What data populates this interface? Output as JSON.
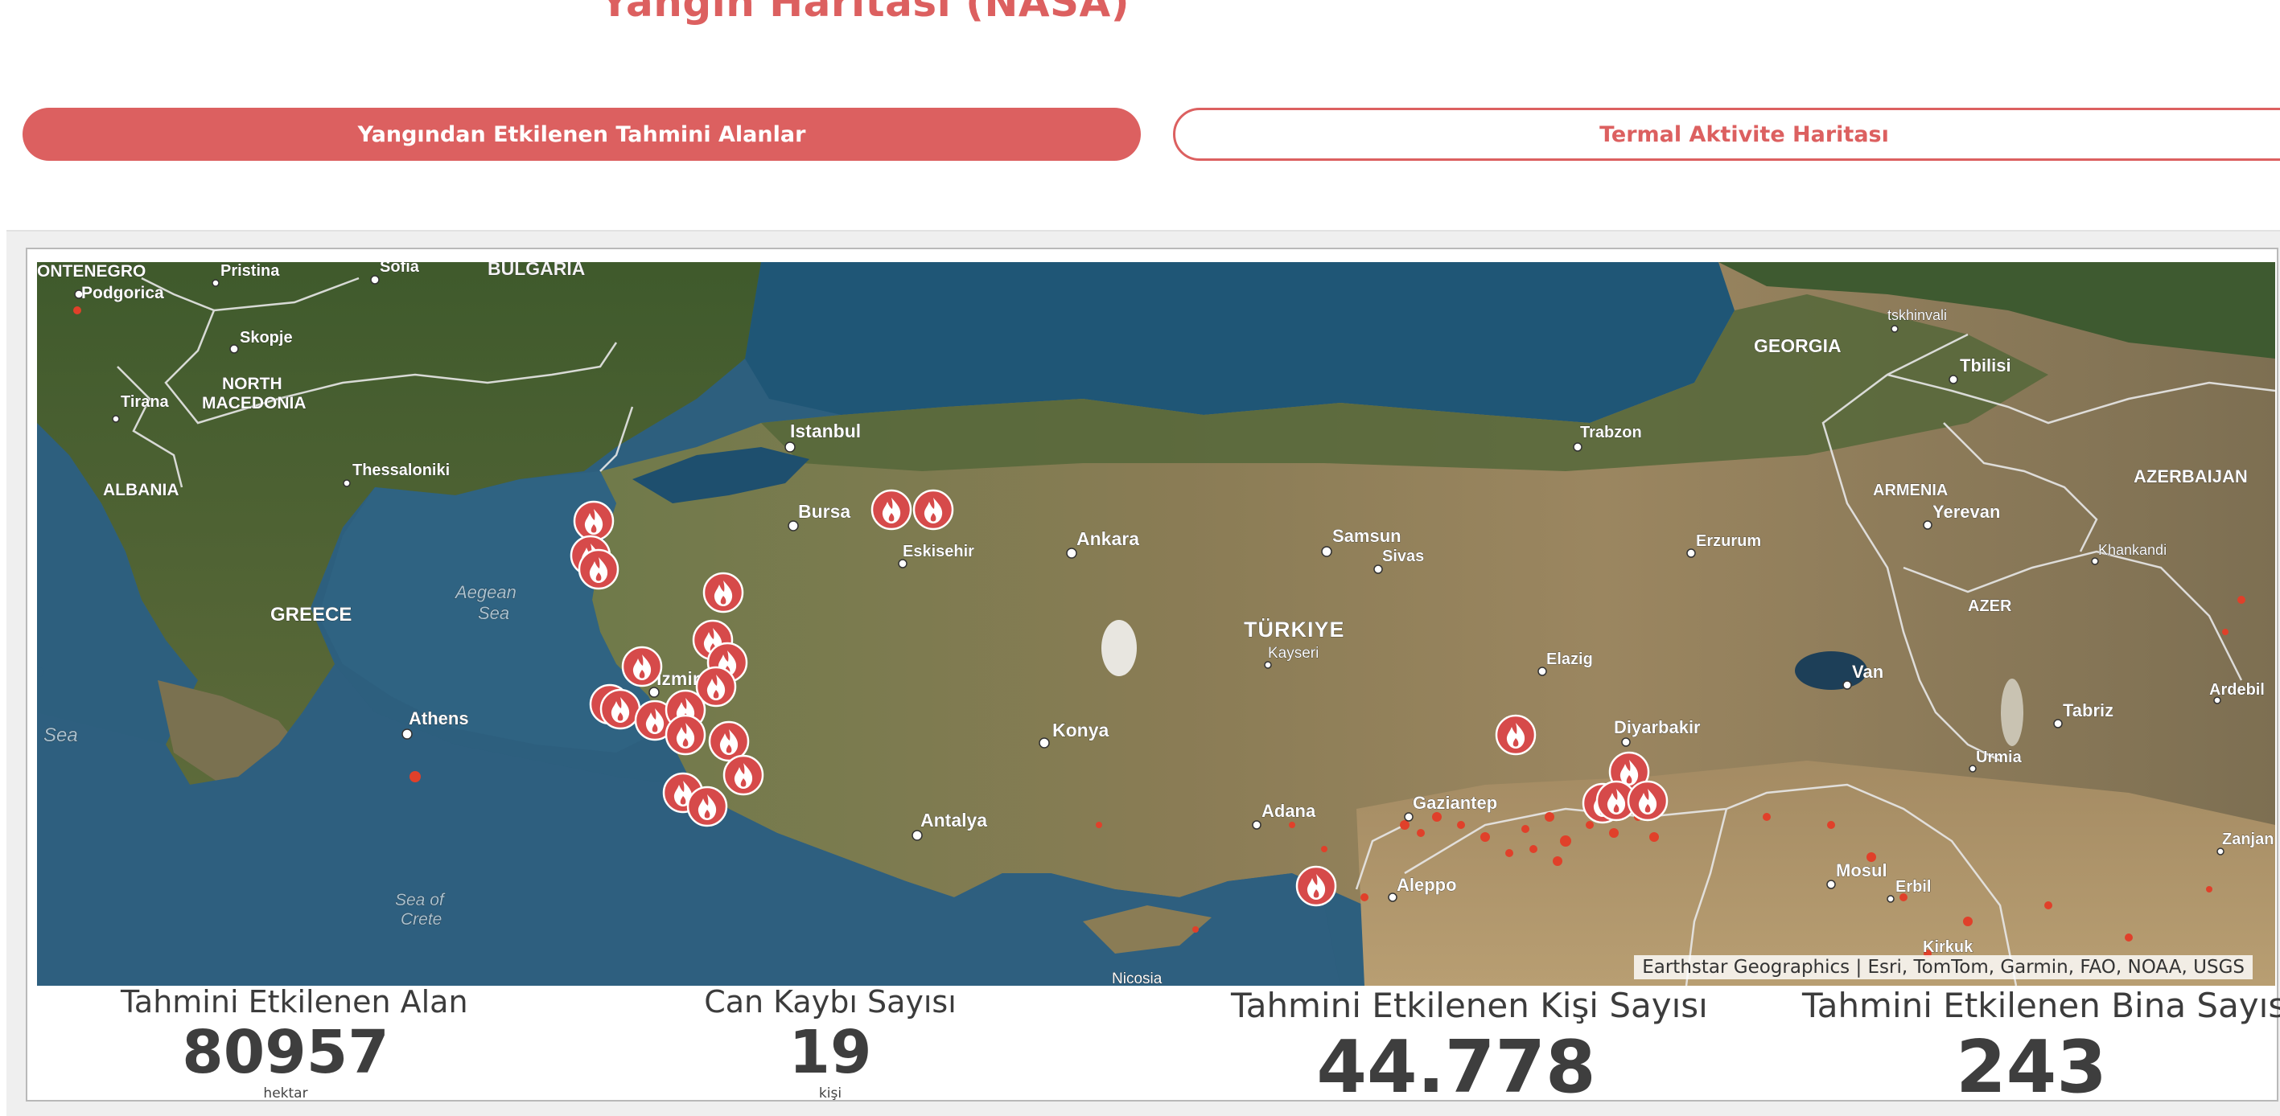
{
  "page": {
    "title": "Yangın Haritası (NASA)"
  },
  "tabs": [
    {
      "label": "Yangından Etkilenen Tahmini Alanlar",
      "active": true
    },
    {
      "label": "Termal Aktivite Haritası",
      "active": false
    }
  ],
  "colors": {
    "accent": "#dc6060",
    "fire_marker": "#d64a4a",
    "hotspot": "#e0402a"
  },
  "map": {
    "attribution": "Earthstar Geographics | Esri, TomTom, Garmin, FAO, NOAA, USGS",
    "labels": {
      "montenegro": "ONTENEGRO",
      "podgorica": "Podgorica",
      "pristina": "Pristina",
      "sofia": "Sofia",
      "bulgaria": "BULGARIA",
      "skopje": "Skopje",
      "north_macedonia_1": "NORTH",
      "north_macedonia_2": "MACEDONIA",
      "tirana": "Tirana",
      "albania": "ALBANIA",
      "thessaloniki": "Thessaloniki",
      "greece": "GREECE",
      "aegean_1": "Aegean",
      "aegean_2": "Sea",
      "sea_left": "Sea",
      "athens": "Athens",
      "crete_1": "Sea of",
      "crete_2": "Crete",
      "istanbul": "Istanbul",
      "bursa": "Bursa",
      "eskisehir": "Eskisehir",
      "ankara": "Ankara",
      "izmir": "Izmir",
      "konya": "Konya",
      "antalya": "Antalya",
      "samsun": "Samsun",
      "trabzon": "Trabzon",
      "sivas": "Sivas",
      "erzurum": "Erzurum",
      "turkiye": "TÜRKIYE",
      "kayseri": "Kayseri",
      "elazig": "Elazig",
      "diyarbakir": "Diyarbakir",
      "van": "Van",
      "adana": "Adana",
      "gaziantep": "Gaziantep",
      "aleppo": "Aleppo",
      "nicosia": "Nicosia",
      "mosul": "Mosul",
      "erbil": "Erbil",
      "kirkuk": "Kirkuk",
      "georgia": "GEORGIA",
      "tskhinvali": "tskhinvali",
      "tbilisi": "Tbilisi",
      "armenia": "ARMENIA",
      "yerevan": "Yerevan",
      "azerbaijan": "AZERBAIJAN",
      "khankandi": "Khankandi",
      "azer": "AZER",
      "tabriz": "Tabriz",
      "urmia": "Urmia",
      "ardebil": "Ardebil",
      "zanjan": "Zanjan"
    },
    "fire_icon": "flame-icon"
  },
  "stats": [
    {
      "label": "Tahmini Etkilenen Alan",
      "value": "80957",
      "unit": "hektar"
    },
    {
      "label": "Can Kaybı Sayısı",
      "value": "19",
      "unit": "kişi"
    },
    {
      "label": "Tahmini Etkilenen Kişi Sayısı",
      "value": "44.778",
      "unit": ""
    },
    {
      "label": "Tahmini Etkilenen Bina Sayısı",
      "value": "243",
      "unit": ""
    }
  ]
}
